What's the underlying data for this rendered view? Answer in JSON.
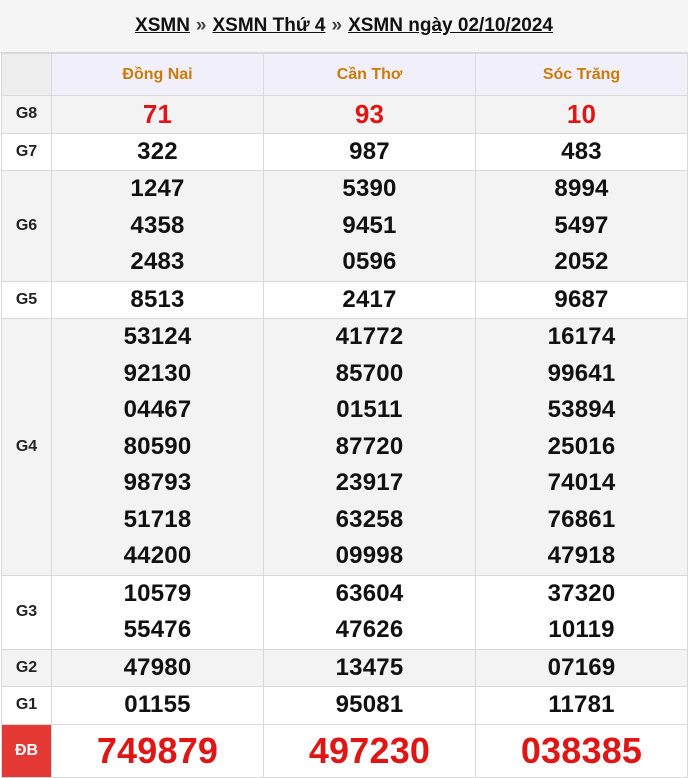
{
  "breadcrumb": {
    "link1": "XSMN",
    "sep1": "»",
    "link2": "XSMN Thứ 4",
    "sep2": "»",
    "link3": "XSMN ngày 02/10/2024"
  },
  "provinces": [
    "Đồng Nai",
    "Cần Thơ",
    "Sóc Trăng"
  ],
  "prizes": [
    {
      "label": "G8",
      "numbers": [
        [
          "71"
        ],
        [
          "93"
        ],
        [
          "10"
        ]
      ]
    },
    {
      "label": "G7",
      "numbers": [
        [
          "322"
        ],
        [
          "987"
        ],
        [
          "483"
        ]
      ]
    },
    {
      "label": "G6",
      "numbers": [
        [
          "1247",
          "4358",
          "2483"
        ],
        [
          "5390",
          "9451",
          "0596"
        ],
        [
          "8994",
          "5497",
          "2052"
        ]
      ]
    },
    {
      "label": "G5",
      "numbers": [
        [
          "8513"
        ],
        [
          "2417"
        ],
        [
          "9687"
        ]
      ]
    },
    {
      "label": "G4",
      "numbers": [
        [
          "53124",
          "92130",
          "04467",
          "80590",
          "98793",
          "51718",
          "44200"
        ],
        [
          "41772",
          "85700",
          "01511",
          "87720",
          "23917",
          "63258",
          "09998"
        ],
        [
          "16174",
          "99641",
          "53894",
          "25016",
          "74014",
          "76861",
          "47918"
        ]
      ]
    },
    {
      "label": "G3",
      "numbers": [
        [
          "10579",
          "55476"
        ],
        [
          "63604",
          "47626"
        ],
        [
          "37320",
          "10119"
        ]
      ]
    },
    {
      "label": "G2",
      "numbers": [
        [
          "47980"
        ],
        [
          "13475"
        ],
        [
          "07169"
        ]
      ]
    },
    {
      "label": "G1",
      "numbers": [
        [
          "01155"
        ],
        [
          "95081"
        ],
        [
          "11781"
        ]
      ]
    },
    {
      "label": "ĐB",
      "numbers": [
        [
          "749879"
        ],
        [
          "497230"
        ],
        [
          "038385"
        ]
      ]
    }
  ],
  "colors": {
    "province_header": "#ca7b0a",
    "special_prize": "#e01616",
    "special_label_bg": "#e53935",
    "header_bg": "#f0effa"
  }
}
